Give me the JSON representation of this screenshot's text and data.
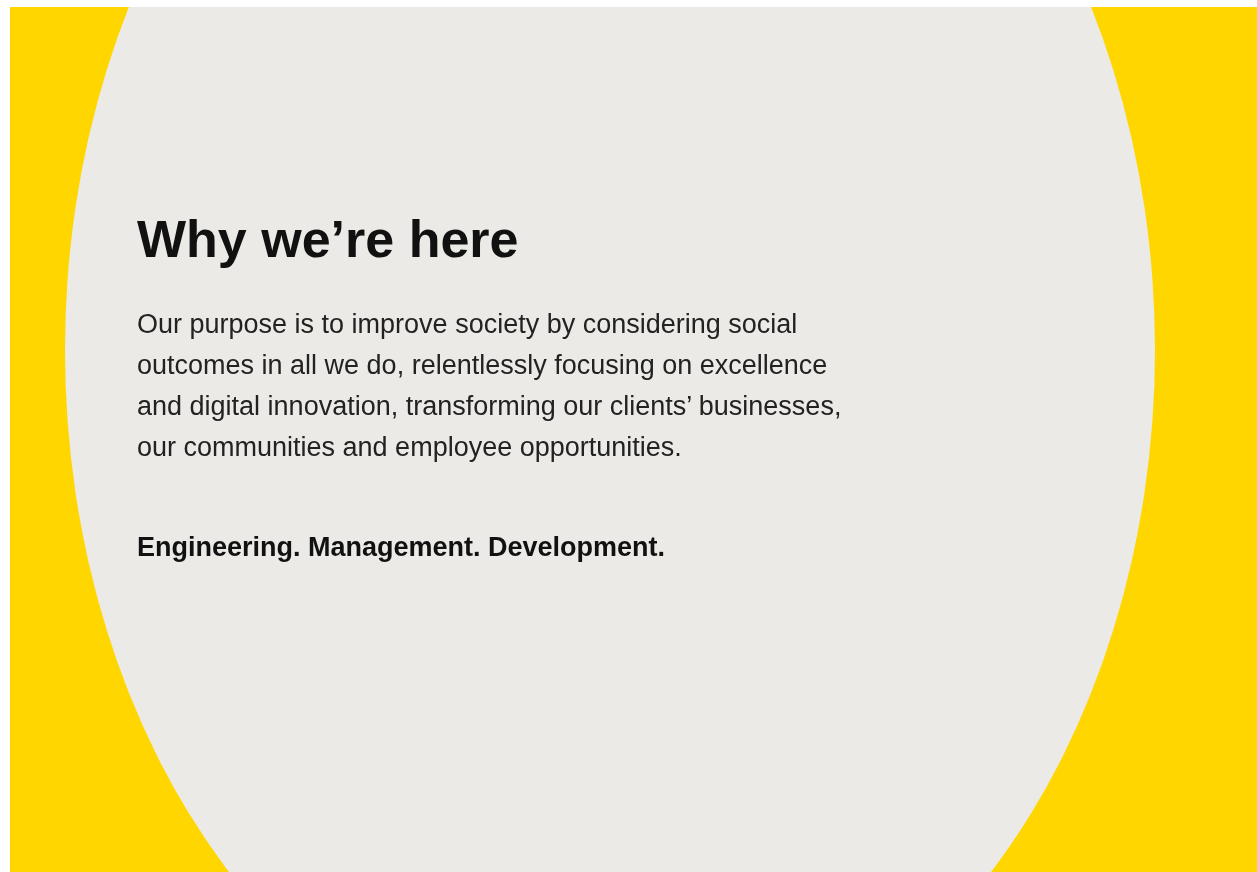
{
  "section": {
    "heading": "Why we’re here",
    "paragraph": "Our purpose is to improve society by considering social outcomes in all we do, relentlessly focusing on excellence and digital innovation, transforming our clients’ businesses, our communities and employee opportunities.",
    "tagline": "Engineering. Management. Development."
  }
}
